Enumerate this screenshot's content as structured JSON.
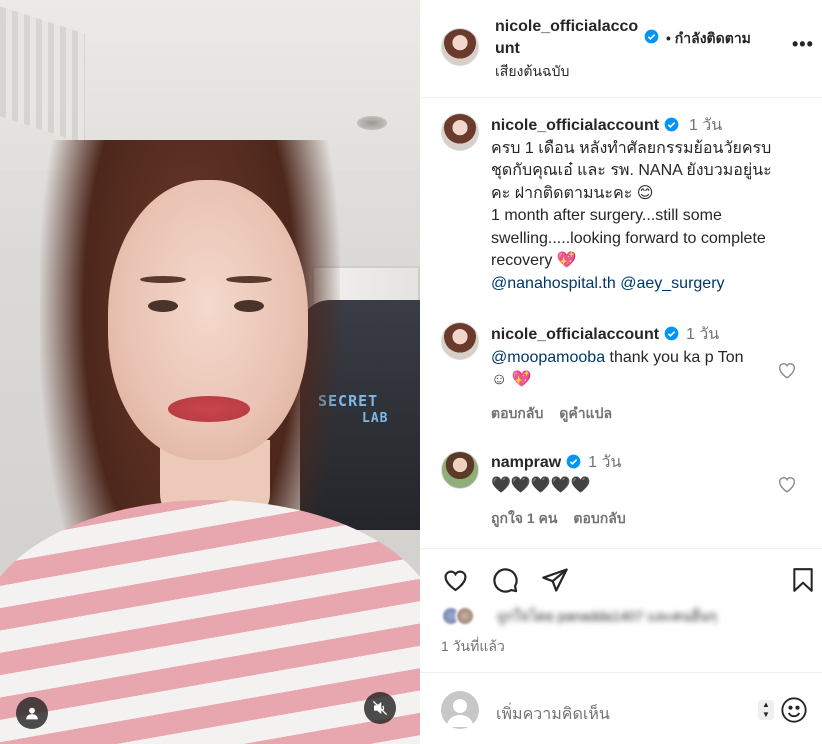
{
  "post": {
    "username": "nicole_officialaccount",
    "follow_label": "• กำลังติดตาม",
    "more_label": "•••",
    "audio_label": "เสียงต้นฉบับ"
  },
  "caption": {
    "username": "nicole_officialaccount",
    "time": "1 วัน",
    "text_th": "ครบ 1 เดือน หลังทำศัลยกรรมย้อนวัยครบชุดกับคุณเอ๋ และ รพ. NANA ยังบวมอยู่นะคะ ฝากติดตามนะคะ 😊",
    "text_en": "1 month after surgery...still some swelling.....looking forward to complete recovery 💖",
    "mention_1": "@nanahospital.th",
    "mention_2": "@aey_surgery"
  },
  "comments": [
    {
      "username": "nicole_officialaccount",
      "time": "1 วัน",
      "mention": "@moopamooba",
      "text": " thank you ka p Ton ☺ 💖",
      "reply_label": "ตอบกลับ",
      "translate_label": "ดูคำแปล"
    },
    {
      "username": "nampraw",
      "time": "1 วัน",
      "text": "🖤🖤🖤🖤🖤",
      "likes_label": "ถูกใจ 1 คน",
      "reply_label": "ตอบกลับ"
    }
  ],
  "likes_text": "ถูกใจโดย panadda1407 และคนอื่นๆ",
  "date_label": "1 วันที่แล้ว",
  "add_comment": {
    "placeholder": "เพิ่มความคิดเห็น"
  },
  "media_overlay_text": {
    "line1": "SECRET",
    "line2": "LAB"
  },
  "colors": {
    "verified": "#0095f6",
    "mention": "#00376b",
    "muted": "#737373",
    "text": "#262626"
  },
  "icons": [
    "user-tag-icon",
    "mute-icon",
    "heart-icon",
    "comment-icon",
    "share-icon",
    "bookmark-icon",
    "emoji-icon",
    "verified-icon"
  ]
}
